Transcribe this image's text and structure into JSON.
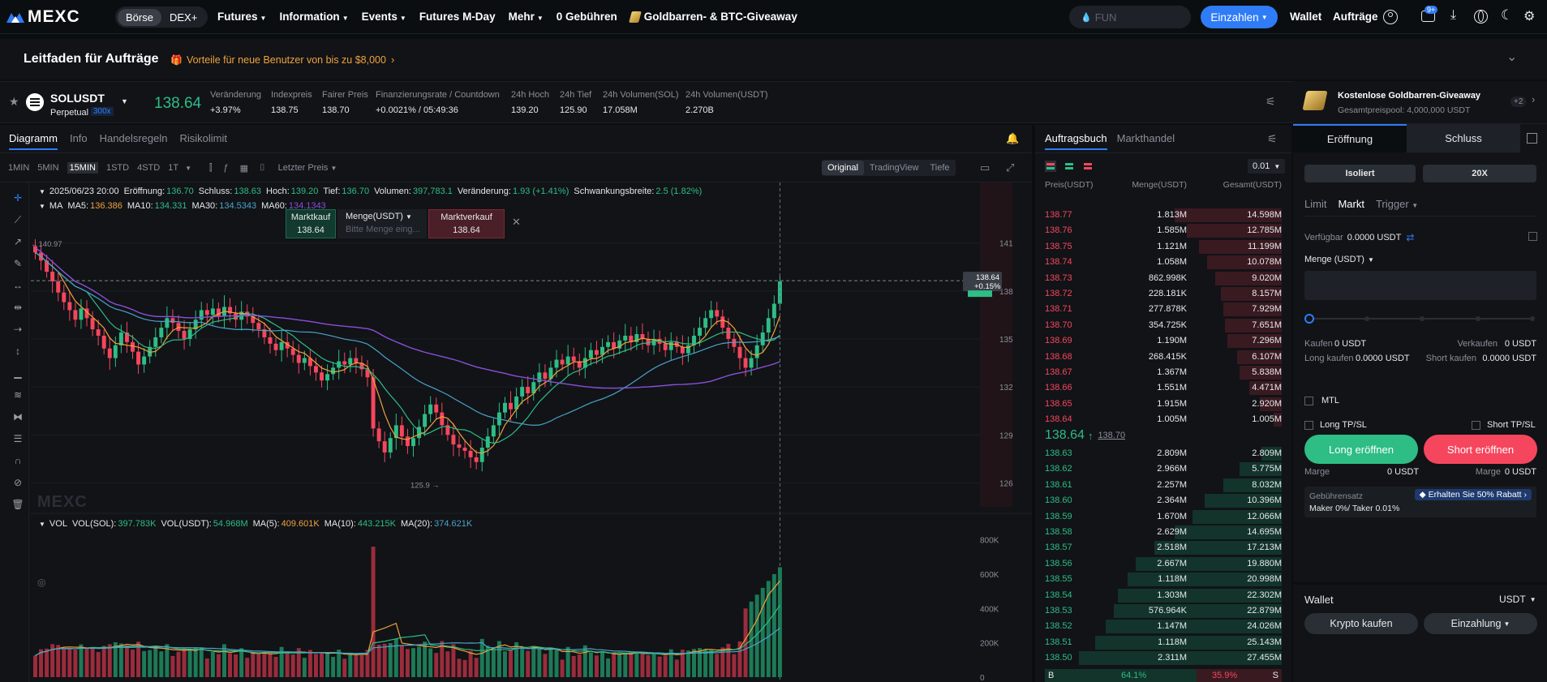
{
  "nav": {
    "logo": "MEXC",
    "seg": [
      "Börse",
      "DEX+"
    ],
    "items": [
      "Futures",
      "Information",
      "Events",
      "Futures M-Day",
      "Mehr",
      "0 Gebühren",
      "Goldbarren- & BTC-Giveaway"
    ],
    "search_placeholder": "FUN",
    "deposit": "Einzahlen",
    "wallet": "Wallet",
    "orders": "Aufträge",
    "badge": "9+"
  },
  "subheader": {
    "title": "Leitfaden für Aufträge",
    "promo": "Vorteile für neue Benutzer von bis zu $8,000"
  },
  "ticker": {
    "symbol": "SOLUSDT",
    "type": "Perpetual",
    "leverage": "300x",
    "price": "138.64",
    "stats": [
      {
        "label": "Veränderung",
        "value": "+3.97%"
      },
      {
        "label": "Indexpreis",
        "value": "138.75"
      },
      {
        "label": "Fairer Preis",
        "value": "138.70"
      },
      {
        "label": "Finanzierungsrate / Countdown",
        "value": "+0.0021% / 05:49:36"
      },
      {
        "label": "24h Hoch",
        "value": "139.20"
      },
      {
        "label": "24h Tief",
        "value": "125.90"
      },
      {
        "label": "24h Volumen(SOL)",
        "value": "17.058M"
      },
      {
        "label": "24h Volumen(USDT)",
        "value": "2.270B"
      }
    ]
  },
  "chart": {
    "tabs": [
      "Diagramm",
      "Info",
      "Handelsregeln",
      "Risikolimit"
    ],
    "intervals": [
      "1MIN",
      "5MIN",
      "15MIN",
      "1STD",
      "4STD",
      "1T"
    ],
    "price_type": "Letzter Preis",
    "views": [
      "Original",
      "TradingView",
      "Tiefe"
    ],
    "ohlc": {
      "date": "2025/06/23 20:00",
      "open_l": "Eröffnung:",
      "open": "136.70",
      "close_l": "Schluss:",
      "close": "138.63",
      "high_l": "Hoch:",
      "high": "139.20",
      "low_l": "Tief:",
      "low": "136.70",
      "vol_l": "Volumen:",
      "vol": "397,783.1",
      "chg_l": "Veränderung:",
      "chg": "1.93 (+1.41%)",
      "amp_l": "Schwankungsbreite:",
      "amp": "2.5 (1.82%)"
    },
    "ma": {
      "label": "MA",
      "ma5_l": "MA5:",
      "ma5": "136.386",
      "ma10_l": "MA10:",
      "ma10": "134.331",
      "ma30_l": "MA30:",
      "ma30": "134.5343",
      "ma60_l": "MA60:",
      "ma60": "134.1343"
    },
    "quick": {
      "buy": "Marktkauf",
      "buy_price": "138.64",
      "amount": "Menge(USDT)",
      "amount_placeholder": "Bitte Menge eing...",
      "sell": "Marktverkauf",
      "sell_price": "138.64"
    },
    "price_axis": [
      "141",
      "138",
      "135",
      "132",
      "129",
      "126"
    ],
    "current_price": "138.64",
    "current_change": "+0.15%",
    "high_mark": "140.97",
    "low_mark": "125.9",
    "watermark": "MEXC",
    "vol": {
      "label": "VOL",
      "sol_l": "VOL(SOL):",
      "sol": "397.783K",
      "usdt_l": "VOL(USDT):",
      "usdt": "54.968M",
      "ma5_l": "MA(5):",
      "ma5": "409.601K",
      "ma10_l": "MA(10):",
      "ma10": "443.215K",
      "ma20_l": "MA(20):",
      "ma20": "374.621K"
    },
    "vol_axis": [
      "800K",
      "600K",
      "400K",
      "200K",
      "0"
    ],
    "colors": {
      "up": "#2ebd85",
      "down": "#f6465d",
      "ma5": "#f0a23b",
      "ma10": "#2ebd85",
      "ma30": "#4aa3c8",
      "ma60": "#8a4fd8"
    }
  },
  "chart_data": {
    "type": "candlestick",
    "interval": "15MIN",
    "symbol": "SOLUSDT",
    "ylim": [
      124.5,
      142.5
    ],
    "last_candle": {
      "open": 136.7,
      "high": 139.2,
      "low": 136.7,
      "close": 138.63
    },
    "close_series": [
      140.4,
      139.9,
      139.2,
      138.6,
      137.9,
      137.3,
      136.8,
      136.2,
      136.9,
      136.3,
      135.6,
      135.2,
      134.4,
      133.8,
      134.6,
      135.4,
      134.8,
      134.2,
      133.4,
      133.9,
      134.5,
      135.1,
      135.7,
      136.3,
      136.0,
      135.5,
      135.0,
      135.6,
      136.2,
      136.8,
      136.5,
      136.9,
      136.4,
      137.0,
      136.6,
      136.2,
      136.7,
      136.4,
      136.0,
      135.6,
      135.1,
      134.7,
      134.3,
      134.8,
      134.4,
      134.0,
      133.5,
      133.8,
      133.3,
      132.9,
      132.4,
      132.8,
      133.2,
      133.6,
      133.4,
      133.8,
      133.5,
      133.1,
      132.6,
      129.4,
      128.6,
      127.9,
      128.8,
      129.6,
      128.9,
      128.3,
      128.8,
      129.5,
      130.3,
      130.9,
      130.4,
      129.6,
      129.0,
      128.4,
      128.2,
      128.0,
      127.6,
      127.3,
      128.2,
      128.9,
      129.6,
      130.4,
      131.0,
      130.6,
      131.4,
      132.0,
      131.6,
      132.3,
      132.9,
      132.5,
      133.2,
      133.7,
      133.4,
      133.9,
      133.6,
      133.2,
      133.8,
      134.3,
      134.0,
      134.5,
      134.8,
      134.4,
      134.9,
      135.2,
      134.8,
      135.3,
      135.0,
      134.6,
      135.0,
      134.7,
      134.3,
      134.8,
      134.5,
      134.1,
      134.6,
      135.2,
      135.7,
      136.3,
      136.8,
      136.4,
      135.7,
      135.0,
      134.5,
      133.8,
      133.2,
      133.8,
      134.6,
      135.4,
      136.3,
      137.2,
      138.6
    ],
    "ma5_last": 136.386,
    "ma10_last": 134.331,
    "ma30_last": 134.5343,
    "ma60_last": 134.1343,
    "volume_ylim": [
      0,
      850
    ]
  },
  "orderbook": {
    "tabs": [
      "Auftragsbuch",
      "Markthandel"
    ],
    "precision": "0.01",
    "headers": [
      "Preis(USDT)",
      "Menge(USDT)",
      "Gesamt(USDT)"
    ],
    "asks": [
      [
        "138.77",
        "1.813M",
        "14.598M",
        0.53
      ],
      [
        "138.76",
        "1.585M",
        "12.785M",
        0.47
      ],
      [
        "138.75",
        "1.121M",
        "11.199M",
        0.41
      ],
      [
        "138.74",
        "1.058M",
        "10.078M",
        0.37
      ],
      [
        "138.73",
        "862.998K",
        "9.020M",
        0.33
      ],
      [
        "138.72",
        "228.181K",
        "8.157M",
        0.3
      ],
      [
        "138.71",
        "277.878K",
        "7.929M",
        0.29
      ],
      [
        "138.70",
        "354.725K",
        "7.651M",
        0.28
      ],
      [
        "138.69",
        "1.190M",
        "7.296M",
        0.27
      ],
      [
        "138.68",
        "268.415K",
        "6.107M",
        0.22
      ],
      [
        "138.67",
        "1.367M",
        "5.838M",
        0.21
      ],
      [
        "138.66",
        "1.551M",
        "4.471M",
        0.16
      ],
      [
        "138.65",
        "1.915M",
        "2.920M",
        0.11
      ],
      [
        "138.64",
        "1.005M",
        "1.005M",
        0.04
      ]
    ],
    "mid_price": "138.64",
    "mid_index": "138.70",
    "bids": [
      [
        "138.63",
        "2.809M",
        "2.809M",
        0.1
      ],
      [
        "138.62",
        "2.966M",
        "5.775M",
        0.21
      ],
      [
        "138.61",
        "2.257M",
        "8.032M",
        0.29
      ],
      [
        "138.60",
        "2.364M",
        "10.396M",
        0.38
      ],
      [
        "138.59",
        "1.670M",
        "12.066M",
        0.44
      ],
      [
        "138.58",
        "2.629M",
        "14.695M",
        0.53
      ],
      [
        "138.57",
        "2.518M",
        "17.213M",
        0.63
      ],
      [
        "138.56",
        "2.667M",
        "19.880M",
        0.72
      ],
      [
        "138.55",
        "1.118M",
        "20.998M",
        0.76
      ],
      [
        "138.54",
        "1.303M",
        "22.302M",
        0.81
      ],
      [
        "138.53",
        "576.964K",
        "22.879M",
        0.83
      ],
      [
        "138.52",
        "1.147M",
        "24.026M",
        0.87
      ],
      [
        "138.51",
        "1.118M",
        "25.143M",
        0.92
      ],
      [
        "138.50",
        "2.311M",
        "27.455M",
        1.0
      ]
    ],
    "ratio_b_label": "B",
    "ratio_b": "64.1%",
    "ratio_s": "35.9%",
    "ratio_s_label": "S"
  },
  "order": {
    "promo_title": "Kostenlose Goldbarren-Giveaway",
    "promo_sub": "Gesamtpreispool: 4,000,000 USDT",
    "promo_badge": "+2",
    "tabs": [
      "Eröffnung",
      "Schluss"
    ],
    "margin_mode": "Isoliert",
    "leverage": "20X",
    "types": [
      "Limit",
      "Markt",
      "Trigger"
    ],
    "available_l": "Verfügbar",
    "available": "0.0000 USDT",
    "qty_label": "Menge (USDT)",
    "buy_l": "Kaufen",
    "buy_v": "0 USDT",
    "sell_l": "Verkaufen",
    "sell_v": "0 USDT",
    "longbuy_l": "Long kaufen",
    "longbuy_v": "0.0000 USDT",
    "shortbuy_l": "Short kaufen",
    "shortbuy_v": "0.0000 USDT",
    "mtl": "MTL",
    "long_tpsl": "Long TP/SL",
    "short_tpsl": "Short TP/SL",
    "long_btn": "Long eröffnen",
    "short_btn": "Short eröffnen",
    "margin_l": "Marge",
    "margin_v": "0 USDT",
    "margin2_l": "Marge",
    "margin2_v": "0 USDT",
    "fee_l": "Gebührensatz",
    "fee_promo": "Erhalten Sie 50% Rabatt",
    "fee_v": "Maker 0%/ Taker 0.01%",
    "wallet": "Wallet",
    "wallet_ccy": "USDT",
    "buy_crypto": "Krypto kaufen",
    "deposit": "Einzahlung"
  }
}
